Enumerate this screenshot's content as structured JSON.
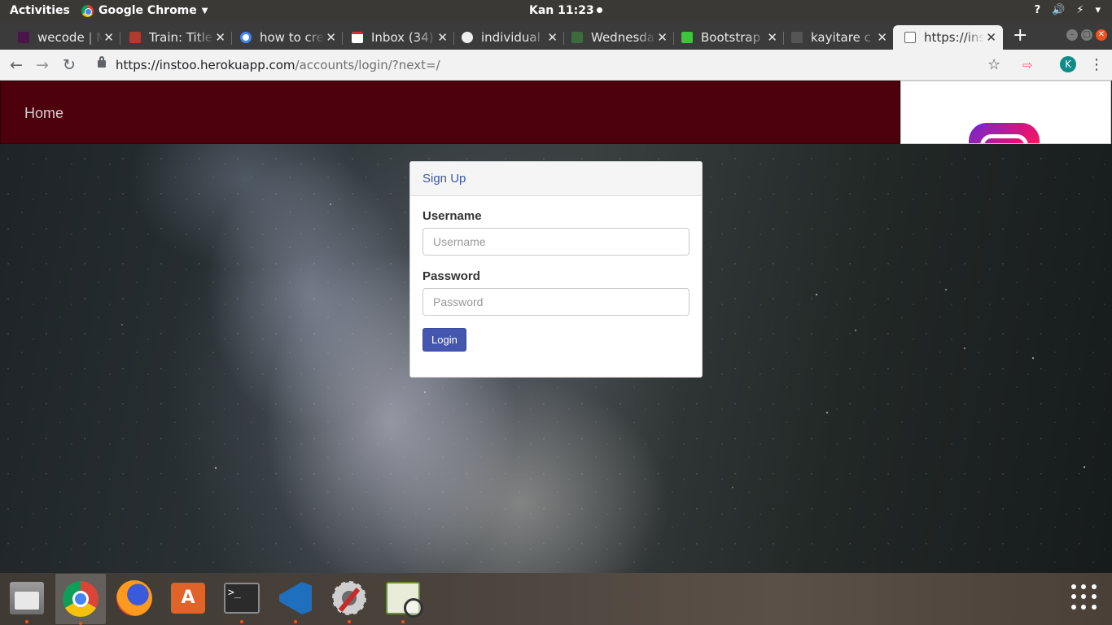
{
  "system": {
    "activities": "Activities",
    "app_name": "Google Chrome",
    "clock": "Kan 11:23",
    "tray": [
      "?",
      "🔊",
      "⚡",
      "▾"
    ]
  },
  "tabs": [
    {
      "title": "wecode | M",
      "favicon_color": "#4a154b"
    },
    {
      "title": "Train: Title",
      "favicon_color": "#b03a2e"
    },
    {
      "title": "how to cre",
      "favicon_color": "#4285f4"
    },
    {
      "title": "Inbox (34)",
      "favicon_color": "#d93025"
    },
    {
      "title": "individual",
      "favicon_color": "#eeeeee"
    },
    {
      "title": "Wednesda",
      "favicon_color": "#3e6b3e"
    },
    {
      "title": "Bootstrap",
      "favicon_color": "#3ec53e"
    },
    {
      "title": "kayitare c",
      "favicon_color": "#555555"
    },
    {
      "title": "https://ins",
      "favicon_color": "#f2f2f2"
    }
  ],
  "omnibox": {
    "host": "https://instoo.herokuapp.com",
    "path": "/accounts/login/?next=/",
    "avatar_letter": "K"
  },
  "navbar": {
    "brand": "Home",
    "color": "#4b000b"
  },
  "login": {
    "header": "Sign Up",
    "username_label": "Username",
    "username_placeholder": "Username",
    "password_label": "Password",
    "password_placeholder": "Password",
    "button": "Login",
    "accent": "#4556b0"
  },
  "dock": {
    "apps": [
      "files-icon",
      "chrome-icon",
      "firefox-icon",
      "software-store-icon",
      "terminal-icon",
      "vscode-icon",
      "settings-tool-icon",
      "image-viewer-icon"
    ]
  }
}
